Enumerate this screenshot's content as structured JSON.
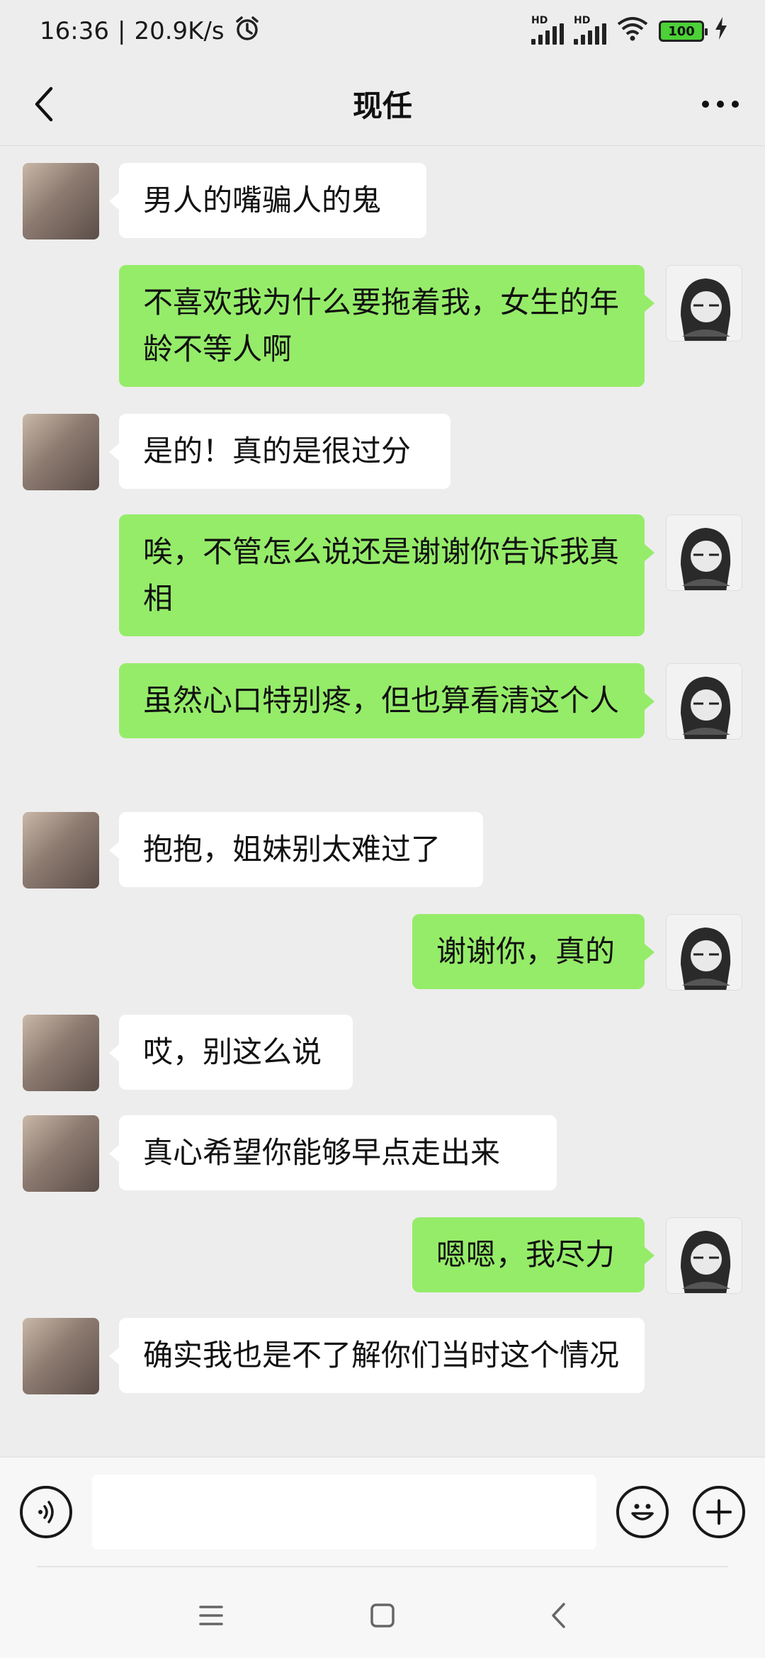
{
  "status_bar": {
    "time": "16:36",
    "separator": "|",
    "net_speed": "20.9K/s",
    "signal1_label": "HD",
    "signal2_label": "HD",
    "battery": "100"
  },
  "header": {
    "title": "现任"
  },
  "messages": [
    {
      "side": "left",
      "text": "男人的嘴骗人的鬼"
    },
    {
      "side": "right",
      "text": "不喜欢我为什么要拖着我，女生的年龄不等人啊"
    },
    {
      "side": "left",
      "text": "是的！真的是很过分"
    },
    {
      "side": "right",
      "text": "唉，不管怎么说还是谢谢你告诉我真相"
    },
    {
      "side": "right",
      "text": "虽然心口特别疼，但也算看清这个人"
    },
    {
      "side": "left",
      "text": "抱抱，姐妹别太难过了"
    },
    {
      "side": "right",
      "text": "谢谢你，真的"
    },
    {
      "side": "left",
      "text": "哎，别这么说"
    },
    {
      "side": "left",
      "text": "真心希望你能够早点走出来"
    },
    {
      "side": "right",
      "text": "嗯嗯，我尽力"
    },
    {
      "side": "left",
      "text": "确实我也是不了解你们当时这个情况"
    }
  ],
  "input": {
    "value": ""
  },
  "colors": {
    "self_bubble": "#95ec69",
    "other_bubble": "#ffffff",
    "background": "#ededed"
  }
}
